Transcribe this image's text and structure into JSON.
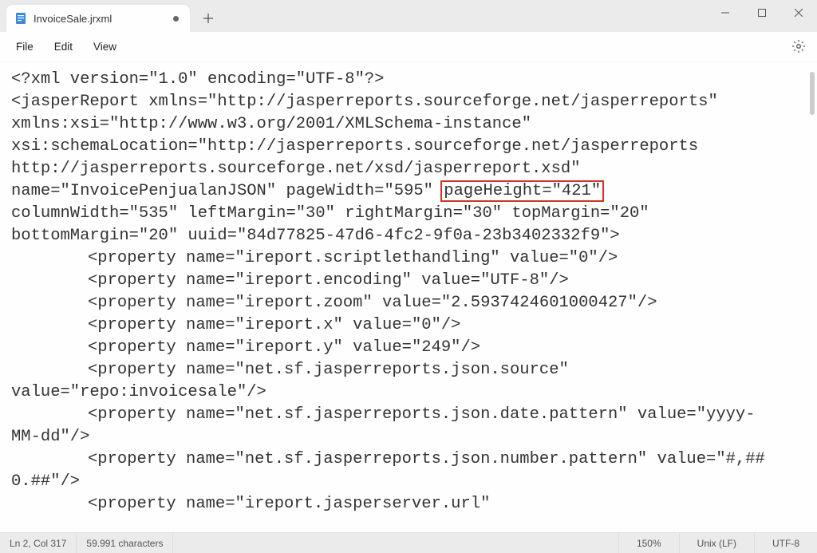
{
  "tab": {
    "filename": "InvoiceSale.jrxml",
    "icon": "file-icon",
    "modified": true
  },
  "menu": {
    "file": "File",
    "edit": "Edit",
    "view": "View"
  },
  "editor": {
    "line01": "<?xml version=\"1.0\" encoding=\"UTF-8\"?>",
    "line02a": "<jasperReport xmlns=\"http://jasperreports.sourceforge.net/jasperreports\" ",
    "line02b": "xmlns:xsi=\"http://www.w3.org/2001/XMLSchema-instance\" ",
    "line02c": "xsi:schemaLocation=\"http://jasperreports.sourceforge.net/jasperreports ",
    "line02d": "http://jasperreports.sourceforge.net/xsd/jasperreport.xsd\" ",
    "line02e_before": "name=\"InvoicePenjualanJSON\" pageWidth=\"595\" ",
    "line02e_highlight": "pageHeight=\"421\"",
    "line02e_after": " ",
    "line02f": "columnWidth=\"535\" leftMargin=\"30\" rightMargin=\"30\" topMargin=\"20\" ",
    "line02g": "bottomMargin=\"20\" uuid=\"84d77825-47d6-4fc2-9f0a-23b3402332f9\">",
    "line03": "<property name=\"ireport.scriptlethandling\" value=\"0\"/>",
    "line04": "<property name=\"ireport.encoding\" value=\"UTF-8\"/>",
    "line05": "<property name=\"ireport.zoom\" value=\"2.5937424601000427\"/>",
    "line06": "<property name=\"ireport.x\" value=\"0\"/>",
    "line07": "<property name=\"ireport.y\" value=\"249\"/>",
    "line08a": "<property name=\"net.sf.jasperreports.json.source\" ",
    "line08b": "value=\"repo:invoicesale\"/>",
    "line09a": "<property name=\"net.sf.jasperreports.json.date.pattern\" value=\"yyyy-",
    "line09b": "MM-dd\"/>",
    "line10a": "<property name=\"net.sf.jasperreports.json.number.pattern\" value=\"#,##",
    "line10b": "0.##\"/>",
    "line11": "<property name=\"ireport.jasperserver.url\" "
  },
  "status": {
    "position": "Ln 2, Col 317",
    "chars": "59.991 characters",
    "zoom": "150%",
    "lineending": "Unix (LF)",
    "encoding": "UTF-8"
  }
}
